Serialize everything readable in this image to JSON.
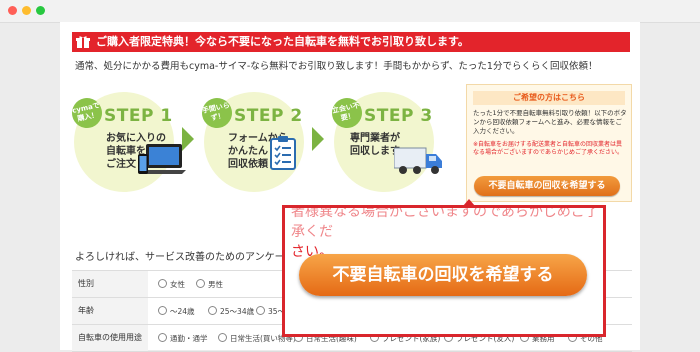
{
  "window": {
    "dot_colors": [
      "#ff5f57",
      "#febc2e",
      "#28c840"
    ]
  },
  "banner": {
    "text": "ご購入者限定特典！今なら不要になった自転車を無料でお引取り致します。"
  },
  "intro": "通常、処分にかかる費用もcyma-サイマ-なら無料でお引取り致します！手間もかからず、たった1分でらくらく回収依頼！",
  "steps": [
    {
      "badge": "cymaで購入！",
      "number": "STEP 1",
      "text": "お気に入りの\n自転車を\nご注文",
      "icon": "laptop-phone-icon"
    },
    {
      "badge": "手間いらず！",
      "number": "STEP 2",
      "text": "フォームから\nかんたん\n回収依頼",
      "icon": "clipboard-icon"
    },
    {
      "badge": "立会い不要！",
      "number": "STEP 3",
      "text": "専門業者が\n回収します",
      "icon": "truck-icon"
    }
  ],
  "sidebox": {
    "heading": "ご希望の方はこちら",
    "description": "たった1分で不要自転車無料引取り依頼！以下のボタンから回収依頼フォームへと進み、必要な情報をご入力ください。",
    "note": "※自転車をお届けする配送業者と自転車の回収業者は異なる場合がございますのであらかじめご了承ください。",
    "button": "不要自転車の回収を希望する"
  },
  "survey": {
    "title": "よろしければ、サービス改善のためのアンケート",
    "rows": [
      {
        "label": "性別",
        "options": [
          "女性",
          "男性"
        ]
      },
      {
        "label": "年齢",
        "options": [
          "〜24歳",
          "25〜34歳",
          "35〜"
        ]
      },
      {
        "label": "自転車の使用用途",
        "options": [
          "通勤・通学",
          "日常生活(買い物等)",
          "日常生活(趣味)",
          "プレゼント(家族)",
          "プレゼント(友人)",
          "業務用",
          "その他"
        ]
      }
    ]
  },
  "zoom": {
    "text_top": "者様異なる場合がございますのであらかじめご了承くだ",
    "text_bottom": "さい。",
    "button": "不要自転車の回収を希望する"
  }
}
